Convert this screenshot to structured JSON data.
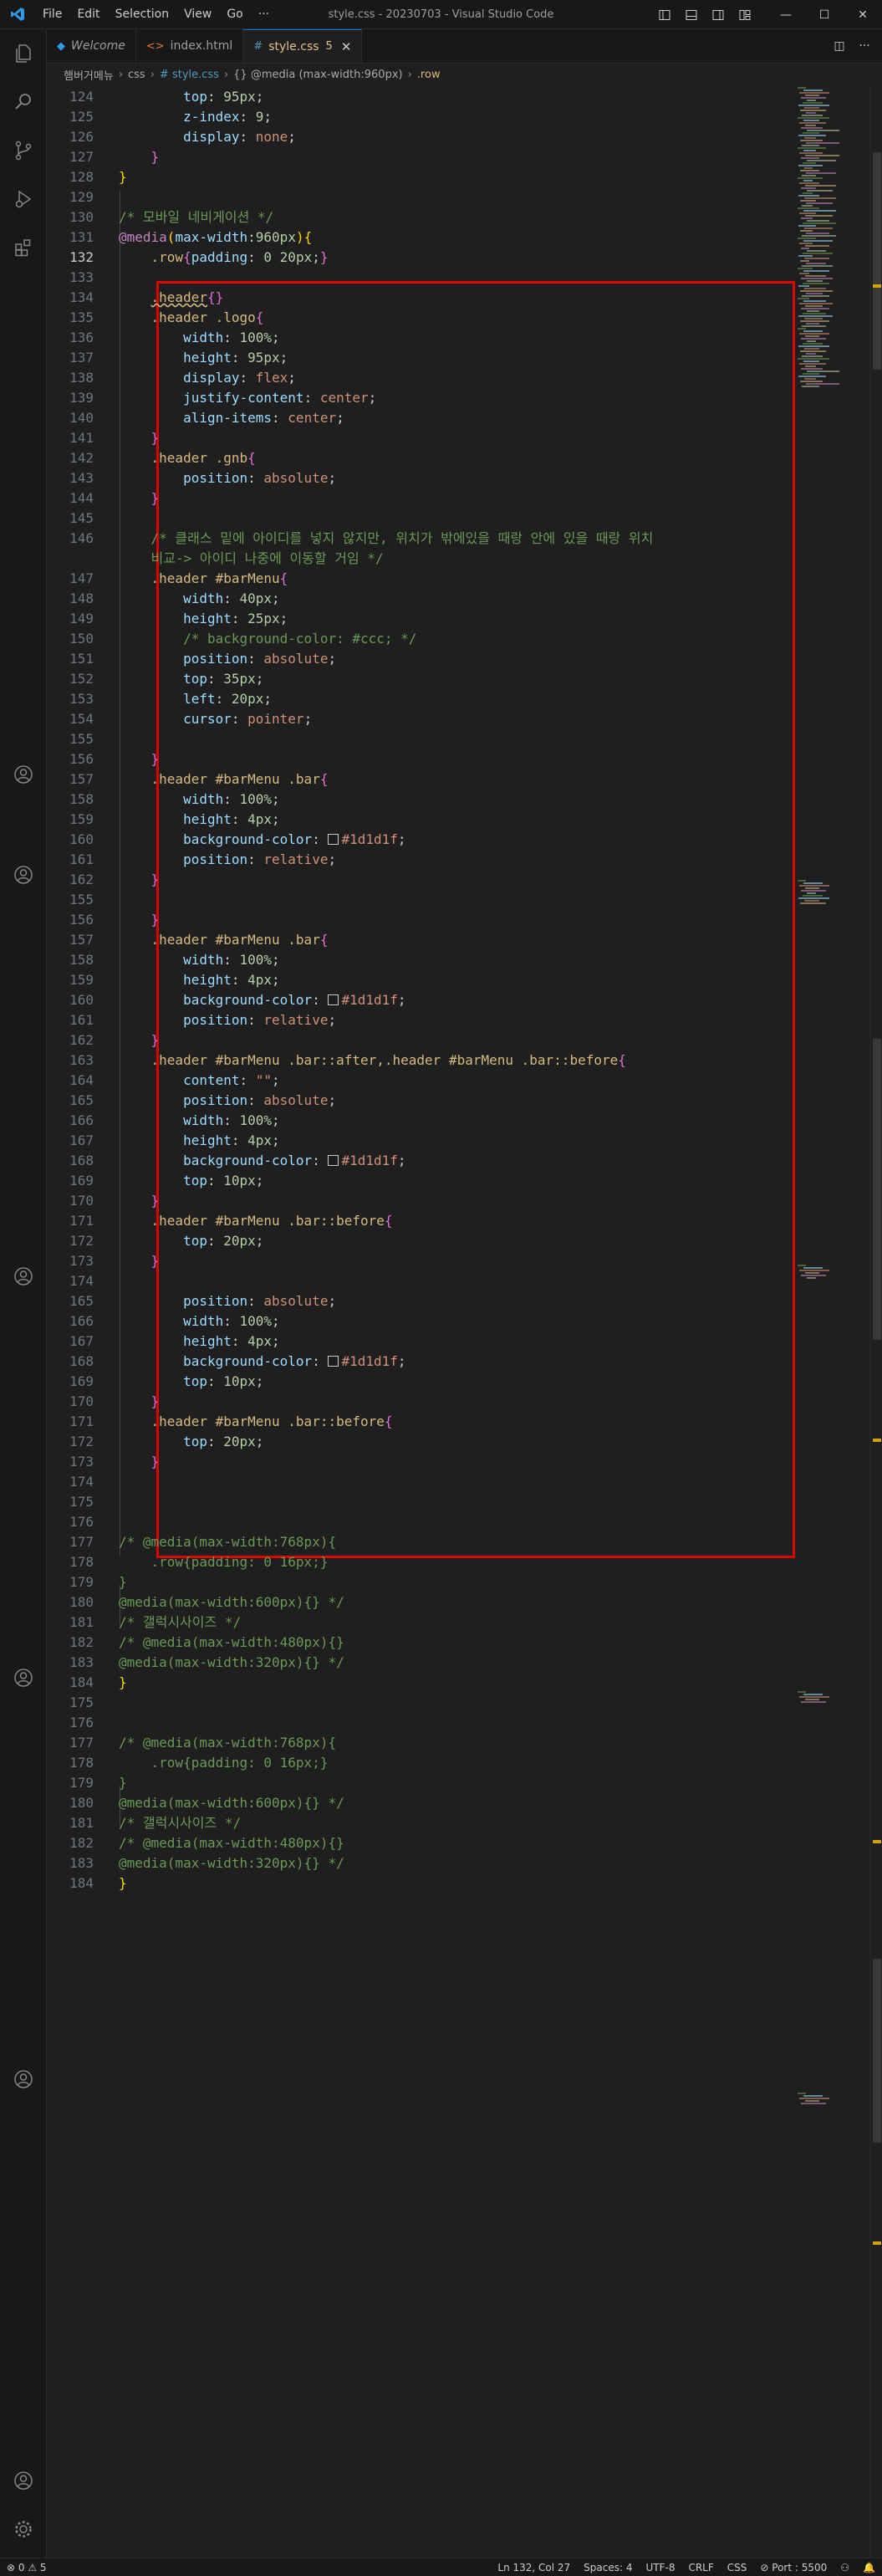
{
  "window": {
    "title": "style.css - 20230703 - Visual Studio Code",
    "menu": [
      "File",
      "Edit",
      "Selection",
      "View",
      "Go",
      "···"
    ]
  },
  "tabs": [
    {
      "label": "Welcome",
      "icon": "vscode-icon",
      "active": false
    },
    {
      "label": "index.html",
      "icon": "html-file-icon",
      "active": false
    },
    {
      "label": "style.css",
      "icon": "css-file-icon",
      "active": true,
      "badge": "5",
      "close": "✕"
    }
  ],
  "breadcrumb": [
    "햄버거메뉴",
    "css",
    "# style.css",
    "{} @media (max-width:960px)",
    ".row"
  ],
  "editor": {
    "lines": [
      {
        "n": "124",
        "t": "        top: 95px;"
      },
      {
        "n": "125",
        "t": "        z-index: 9;"
      },
      {
        "n": "126",
        "t": "        display: none;"
      },
      {
        "n": "127",
        "t": "    }"
      },
      {
        "n": "128",
        "t": "}"
      },
      {
        "n": "129",
        "t": ""
      },
      {
        "n": "130",
        "t": "/* 모바일 네비게이션 */"
      },
      {
        "n": "131",
        "t": "@media(max-width:960px){"
      },
      {
        "n": "132",
        "t": "    .row{padding: 0 20px;}"
      },
      {
        "n": "133",
        "t": ""
      },
      {
        "n": "134",
        "t": "    .header{}"
      },
      {
        "n": "135",
        "t": "    .header .logo{"
      },
      {
        "n": "136",
        "t": "        width: 100%;"
      },
      {
        "n": "137",
        "t": "        height: 95px;"
      },
      {
        "n": "138",
        "t": "        display: flex;"
      },
      {
        "n": "139",
        "t": "        justify-content: center;"
      },
      {
        "n": "140",
        "t": "        align-items: center;"
      },
      {
        "n": "141",
        "t": "    }"
      },
      {
        "n": "142",
        "t": "    .header .gnb{"
      },
      {
        "n": "143",
        "t": "        position: absolute;"
      },
      {
        "n": "144",
        "t": "    }"
      },
      {
        "n": "145",
        "t": ""
      },
      {
        "n": "146",
        "t": "    /* 클래스 밑에 아이디를 넣지 않지만, 위치가 밖에있을 때랑 안에 있을 때랑 위치"
      },
      {
        "n": "",
        "t": "    비교-> 아이디 나중에 이동할 거임 */"
      },
      {
        "n": "147",
        "t": "    .header #barMenu{"
      },
      {
        "n": "148",
        "t": "        width: 40px;"
      },
      {
        "n": "149",
        "t": "        height: 25px;"
      },
      {
        "n": "150",
        "t": "        /* background-color: #ccc; */"
      },
      {
        "n": "151",
        "t": "        position: absolute;"
      },
      {
        "n": "152",
        "t": "        top: 35px;"
      },
      {
        "n": "153",
        "t": "        left: 20px;"
      },
      {
        "n": "154",
        "t": "        cursor: pointer;"
      },
      {
        "n": "155",
        "t": ""
      },
      {
        "n": "156",
        "t": "    }"
      },
      {
        "n": "157",
        "t": "    .header #barMenu .bar{"
      },
      {
        "n": "158",
        "t": "        width: 100%;"
      },
      {
        "n": "159",
        "t": "        height: 4px;"
      },
      {
        "n": "160",
        "t": "        background-color: #1d1d1f;"
      },
      {
        "n": "161",
        "t": "        position: relative;"
      },
      {
        "n": "162",
        "t": "    }"
      },
      {
        "n": "155",
        "t": ""
      },
      {
        "n": "156",
        "t": "    }"
      },
      {
        "n": "157",
        "t": "    .header #barMenu .bar{"
      },
      {
        "n": "158",
        "t": "        width: 100%;"
      },
      {
        "n": "159",
        "t": "        height: 4px;"
      },
      {
        "n": "160",
        "t": "        background-color: #1d1d1f;"
      },
      {
        "n": "161",
        "t": "        position: relative;"
      },
      {
        "n": "162",
        "t": "    }"
      },
      {
        "n": "163",
        "t": "    .header #barMenu .bar::after,.header #barMenu .bar::before{"
      },
      {
        "n": "164",
        "t": "        content: \"\";"
      },
      {
        "n": "165",
        "t": "        position: absolute;"
      },
      {
        "n": "166",
        "t": "        width: 100%;"
      },
      {
        "n": "167",
        "t": "        height: 4px;"
      },
      {
        "n": "168",
        "t": "        background-color: #1d1d1f;"
      },
      {
        "n": "169",
        "t": "        top: 10px;"
      },
      {
        "n": "170",
        "t": "    }"
      },
      {
        "n": "171",
        "t": "    .header #barMenu .bar::before{"
      },
      {
        "n": "172",
        "t": "        top: 20px;"
      },
      {
        "n": "173",
        "t": "    }"
      },
      {
        "n": "174",
        "t": ""
      },
      {
        "n": "165",
        "t": "        position: absolute;"
      },
      {
        "n": "166",
        "t": "        width: 100%;"
      },
      {
        "n": "167",
        "t": "        height: 4px;"
      },
      {
        "n": "168",
        "t": "        background-color: #1d1d1f;"
      },
      {
        "n": "169",
        "t": "        top: 10px;"
      },
      {
        "n": "170",
        "t": "    }"
      },
      {
        "n": "171",
        "t": "    .header #barMenu .bar::before{"
      },
      {
        "n": "172",
        "t": "        top: 20px;"
      },
      {
        "n": "173",
        "t": "    }"
      },
      {
        "n": "174",
        "t": ""
      },
      {
        "n": "175",
        "t": ""
      },
      {
        "n": "176",
        "t": ""
      },
      {
        "n": "177",
        "t": "/* @media(max-width:768px){"
      },
      {
        "n": "178",
        "t": "    .row{padding: 0 16px;}"
      },
      {
        "n": "179",
        "t": "}"
      },
      {
        "n": "180",
        "t": "@media(max-width:600px){} */"
      },
      {
        "n": "181",
        "t": "/* 갤럭시사이즈 */"
      },
      {
        "n": "182",
        "t": "/* @media(max-width:480px){}"
      },
      {
        "n": "183",
        "t": "@media(max-width:320px){} */"
      },
      {
        "n": "184",
        "t": "}"
      },
      {
        "n": "175",
        "t": ""
      },
      {
        "n": "176",
        "t": ""
      },
      {
        "n": "177",
        "t": "/* @media(max-width:768px){"
      },
      {
        "n": "178",
        "t": "    .row{padding: 0 16px;}"
      },
      {
        "n": "179",
        "t": "}"
      },
      {
        "n": "180",
        "t": "@media(max-width:600px){} */"
      },
      {
        "n": "181",
        "t": "/* 갤럭시사이즈 */"
      },
      {
        "n": "182",
        "t": "/* @media(max-width:480px){}"
      },
      {
        "n": "183",
        "t": "@media(max-width:320px){} */"
      },
      {
        "n": "184",
        "t": "}"
      }
    ]
  },
  "statusbar": {
    "problems": "⊗ 0 ⚠ 5",
    "position": "Ln 132, Col 27",
    "spaces": "Spaces: 4",
    "encoding": "UTF-8",
    "eol": "CRLF",
    "language": "CSS",
    "port": "⊘ Port : 5500"
  },
  "colors": {
    "highlight_box": "#e00000",
    "accent": "#0078d4"
  }
}
